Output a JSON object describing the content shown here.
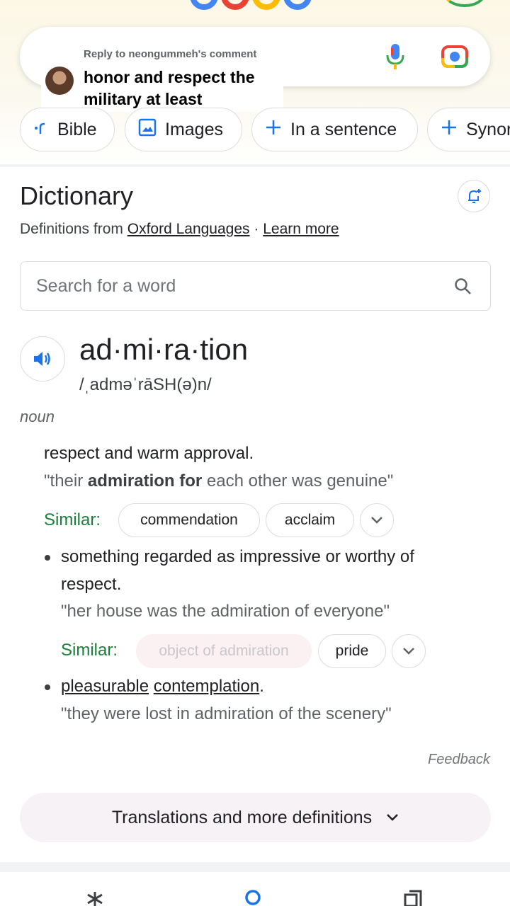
{
  "comment": {
    "header": "Reply to neongummeh's comment",
    "text": "honor and respect the military at least"
  },
  "chips": [
    {
      "label": "Bible",
      "icon": "bible-icon"
    },
    {
      "label": "Images",
      "icon": "image-icon"
    },
    {
      "label": "In a sentence",
      "icon": "plus-icon"
    },
    {
      "label": "Synor",
      "icon": "plus-icon"
    }
  ],
  "dictionary": {
    "title": "Dictionary",
    "defs_from_prefix": "Definitions from",
    "source_link": "Oxford Languages",
    "separator": "·",
    "learn_more": "Learn more",
    "search_placeholder": "Search for a word"
  },
  "entry": {
    "headword": "ad·mi·ra·tion",
    "phonetic": "/ˌadməˈrāSH(ə)n/",
    "part_of_speech": "noun",
    "senses": [
      {
        "definition": "respect and warm approval.",
        "example_open": "\"their ",
        "example_bold": "admiration for",
        "example_rest": " each other was genuine\"",
        "similar_label": "Similar:",
        "similar": [
          "commendation",
          "acclaim"
        ]
      },
      {
        "definition_line1": "something regarded as impressive or worthy of",
        "definition_line2": "respect.",
        "example": "\"her house was the admiration of everyone\"",
        "similar_label": "Similar:",
        "similar": [
          "object of admiration",
          "pride"
        ]
      },
      {
        "definition_word1": "pleasurable",
        "definition_word2": "contemplation",
        "definition_end": ".",
        "example": "\"they were lost in admiration of the scenery\""
      }
    ]
  },
  "feedback": "Feedback",
  "translations_button": "Translations and more definitions",
  "colors": {
    "accent_blue": "#1a73e8",
    "similar_green": "#188038"
  }
}
